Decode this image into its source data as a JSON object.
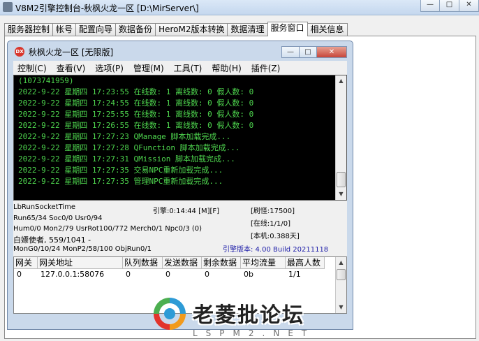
{
  "window": {
    "title": "V8M2引擎控制台-秋枫火龙一区 [D:\\MirServer\\]",
    "minimize_icon": "minimize-icon",
    "maximize_icon": "maximize-icon",
    "close_icon": "close-icon"
  },
  "tabs": [
    {
      "label": "服务器控制"
    },
    {
      "label": "帐号"
    },
    {
      "label": "配置向导"
    },
    {
      "label": "数据备份"
    },
    {
      "label": "HeroM2版本转换"
    },
    {
      "label": "数据清理"
    },
    {
      "label": "服务窗口",
      "active": true
    },
    {
      "label": "相关信息"
    }
  ],
  "inner_window": {
    "title": "秋枫火龙一区 [无限版]",
    "icon_text": "DX",
    "menu": [
      {
        "label": "控制(C)"
      },
      {
        "label": "查看(V)"
      },
      {
        "label": "选项(P)"
      },
      {
        "label": "管理(M)"
      },
      {
        "label": "工具(T)"
      },
      {
        "label": "帮助(H)"
      },
      {
        "label": "插件(Z)"
      }
    ]
  },
  "log": [
    "(1073741959)",
    "2022-9-22 星期四 17:23:55 在线数: 1 离线数: 0 假人数: 0",
    "2022-9-22 星期四 17:24:55 在线数: 1 离线数: 0 假人数: 0",
    "2022-9-22 星期四 17:25:55 在线数: 1 离线数: 0 假人数: 0",
    "2022-9-22 星期四 17:26:55 在线数: 1 离线数: 0 假人数: 0",
    "2022-9-22 星期四 17:27:23 QManage 脚本加载完成...",
    "2022-9-22 星期四 17:27:28 QFunction 脚本加载完成...",
    "2022-9-22 星期四 17:27:31 QMission 脚本加载完成...",
    "2022-9-22 星期四 17:27:35 交易NPC重新加载完成...",
    "2022-9-22 星期四 17:27:35 管理NPC重新加载完成..."
  ],
  "status": {
    "socket": "LbRunSocketTime",
    "run": "Run65/34 Soc0/0 Usr0/94",
    "hum": "Hum0/0 Mon2/79 UsrRot100/772 Merch0/1 Npc0/3 (0)",
    "player": "白嫖使者, 559/1041 -",
    "mon": "MonG0/10/24 MonP2/58/100 ObjRun0/1",
    "engine_time": "引擎:0:14:44 [M][F]",
    "refresh": "[刷怪:17500]",
    "online": "[在线:1/1/0]",
    "local": "[本机:0.388天]",
    "version": "引擎版本: 4.00 Build 20211118"
  },
  "grid": {
    "columns": [
      "网关",
      "网关地址",
      "队列数据",
      "发送数据",
      "剩余数据",
      "平均流量",
      "最高人数"
    ],
    "rows": [
      [
        "0",
        "127.0.0.1:58076",
        "0",
        "0",
        "0",
        "0b",
        "1/1"
      ]
    ]
  },
  "watermark": {
    "title": "老菱批论坛",
    "sub": "LSPM2.NET"
  },
  "colors": {
    "log_text": "#4ed64e",
    "log_bg": "#000000",
    "version_text": "#1c1ca8",
    "title_icon": "#d9362c"
  }
}
